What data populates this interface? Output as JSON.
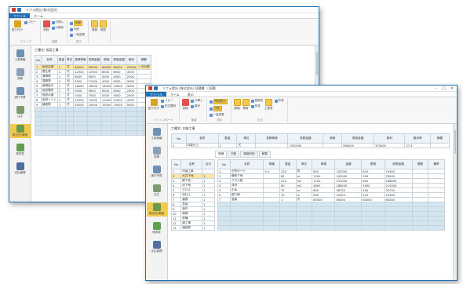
{
  "back_window": {
    "title": "リフォ提出 (株式会社)",
    "menu_tabs": [
      "ファイル",
      "ホーム"
    ],
    "ribbon": {
      "g1": [
        "貼り付け",
        "コピー"
      ],
      "g2": [
        "削除",
        "行挿入",
        "行削除"
      ],
      "g3": [
        "明細",
        "内訳",
        "一括変更"
      ],
      "g4": [
        "原価",
        "積算"
      ],
      "group_labels": [
        "クリップ",
        "編集",
        "表示"
      ]
    },
    "side": [
      "工事情報",
      "見積",
      "実行予算",
      "注文",
      "取引先/明細",
      "請求書",
      "支払管理",
      "総合管理"
    ],
    "sub": "工種名: 仮設工事",
    "headers": [
      "No",
      "名称",
      "数量",
      "単位",
      "見積単価",
      "見積金額",
      "原価",
      "原価金額",
      "粗利",
      "摘要"
    ],
    "rows": [
      [
        "1",
        "仮設足場",
        "1",
        "式",
        "85000",
        "85000",
        "60000",
        "60000",
        "25000",
        "一次元請"
      ],
      [
        "2",
        "養生費",
        "1",
        "式",
        "12000",
        "12000",
        "8000",
        "8000",
        "4000",
        ""
      ],
      [
        "3",
        "清掃費",
        "1",
        "式",
        "6000",
        "6000",
        "4000",
        "4000",
        "2000",
        ""
      ],
      [
        "4",
        "運搬費",
        "2",
        "回",
        "5500",
        "11000",
        "4000",
        "8000",
        "3000",
        ""
      ],
      [
        "5",
        "産廃処分",
        "1",
        "式",
        "18000",
        "18000",
        "14000",
        "14000",
        "4000",
        ""
      ],
      [
        "6",
        "仮設電気",
        "1",
        "式",
        "9000",
        "9000",
        "6500",
        "6500",
        "2500",
        ""
      ],
      [
        "7",
        "仮設水道",
        "1",
        "式",
        "7000",
        "7000",
        "5000",
        "5000",
        "2000",
        ""
      ],
      [
        "8",
        "仮設トイレ",
        "1",
        "式",
        "15000",
        "15000",
        "11000",
        "11000",
        "4000",
        ""
      ],
      [
        "9",
        "諸経費",
        "1",
        "式",
        "20000",
        "20000",
        "15000",
        "15000",
        "5000",
        ""
      ]
    ]
  },
  "front_window": {
    "title": "リフォ提出 (株式会社) 見積書 〔見積〕",
    "menu_tabs": [
      "ファイル",
      "ホーム",
      "表示"
    ],
    "ribbon": {
      "g1": [
        "貼り付け",
        "コピー",
        "形式選択"
      ],
      "g2": [
        "削除",
        "行挿入",
        "複写"
      ],
      "g3": [
        "明細表示",
        "内訳",
        "一括変更"
      ],
      "g4": [
        "原価",
        "積算"
      ],
      "g5": [
        "見積書",
        "作成"
      ],
      "g6": [
        "工程表",
        "作成"
      ],
      "group_labels": [
        "クリップボード",
        "編集",
        "表示",
        "出力"
      ]
    },
    "side": [
      "工事情報",
      "見積",
      "実行予算",
      "注文",
      "取引先/明細",
      "請求書",
      "支払管理",
      "総合管理"
    ],
    "sub": "工種名: 内装工事",
    "top_headers": [
      "No",
      "名称",
      "数量",
      "単位",
      "見積単価",
      "見積金額",
      "原価",
      "原価金額",
      "粗利",
      "粗利率",
      "摘要"
    ],
    "top_row": [
      "1",
      "内装仕上",
      "1",
      "式",
      "",
      "1350000",
      "",
      "980000",
      "370000",
      "27.4",
      ""
    ],
    "subtabs": [
      "明細",
      "内訳",
      "原価内訳",
      "積算"
    ],
    "left_headers": [
      "No",
      "名称",
      "区分"
    ],
    "left_rows": [
      [
        "1",
        "内装工事",
        ""
      ],
      [
        "2",
        "天井下地",
        "1"
      ],
      [
        "3",
        "壁下地",
        "1"
      ],
      [
        "4",
        "床下地",
        "1"
      ],
      [
        "5",
        "クロス",
        "1"
      ],
      [
        "6",
        "床仕上",
        "1"
      ],
      [
        "7",
        "建具",
        "1"
      ],
      [
        "8",
        "塗装",
        "1"
      ],
      [
        "9",
        "造作",
        "1"
      ],
      [
        "10",
        "照明",
        "1"
      ],
      [
        "11",
        "設備",
        "1"
      ],
      [
        "12",
        "雑工事",
        "1"
      ],
      [
        "13",
        "諸経費",
        "1"
      ]
    ],
    "right_headers": [
      "No",
      "名称",
      "規格",
      "数量",
      "単位",
      "単価",
      "金額",
      "原価",
      "原価金額",
      "摘要",
      "備考"
    ],
    "right_rows": [
      [
        "1",
        "石膏ボード",
        "9.5",
        "120",
        "枚",
        "850",
        "102000",
        "620",
        "74400",
        "",
        ""
      ],
      [
        "2",
        "軽鉄下地",
        "",
        "85",
        "m",
        "1200",
        "102000",
        "900",
        "76500",
        "",
        ""
      ],
      [
        "3",
        "クロス貼",
        "",
        "210",
        "m2",
        "1100",
        "231000",
        "800",
        "168000",
        "",
        ""
      ],
      [
        "4",
        "床材",
        "",
        "60",
        "m2",
        "4800",
        "288000",
        "3500",
        "210000",
        "",
        ""
      ],
      [
        "5",
        "巾木",
        "",
        "75",
        "m",
        "650",
        "48750",
        "450",
        "33750",
        "",
        ""
      ],
      [
        "6",
        "廻り縁",
        "",
        "70",
        "m",
        "600",
        "42000",
        "420",
        "29400",
        "",
        ""
      ],
      [
        "7",
        "塗装",
        "",
        "1",
        "式",
        "85000",
        "85000",
        "60000",
        "60000",
        "",
        ""
      ]
    ]
  },
  "colors": {
    "accent": "#1f6fb5",
    "highlight": "#f2c94c",
    "empty_cell": "#d3e6ef"
  }
}
